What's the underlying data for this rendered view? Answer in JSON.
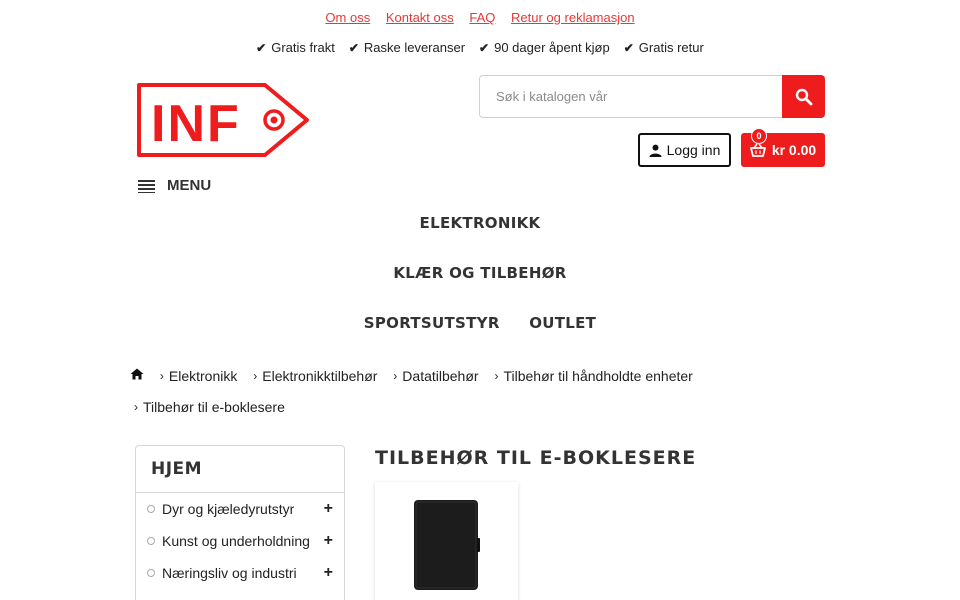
{
  "top_links": [
    "Om oss",
    "Kontakt oss",
    "FAQ",
    "Retur og reklamasjon"
  ],
  "usp": [
    "Gratis frakt",
    "Raske leveranser",
    "90 dager åpent kjøp",
    "Gratis retur"
  ],
  "logo": {
    "text": "INF"
  },
  "search": {
    "placeholder": "Søk i katalogen vår"
  },
  "header": {
    "login_label": "Logg inn",
    "cart_total": "kr 0.00",
    "cart_count": "0"
  },
  "menu": {
    "label": "MENU"
  },
  "nav": {
    "item1": "ELEKTRONIKK",
    "item2": "KLÆR OG TILBEHØR",
    "item3": "SPORTSUTSTYR",
    "item4": "OUTLET"
  },
  "breadcrumb": [
    "Elektronikk",
    "Elektronikktilbehør",
    "Datatilbehør",
    "Tilbehør til håndholdte enheter",
    "Tilbehør til e-boklesere"
  ],
  "sidebar": {
    "title": "HJEM",
    "items": [
      {
        "label": "Dyr og kjæledyrutstyr"
      },
      {
        "label": "Kunst og underholdning"
      },
      {
        "label": "Næringsliv og industri"
      }
    ]
  },
  "category": {
    "title": "TILBEHØR TIL E-BOKLESERE"
  },
  "colors": {
    "accent": "#ee1c1c",
    "link": "#e53935",
    "text": "#222222"
  }
}
